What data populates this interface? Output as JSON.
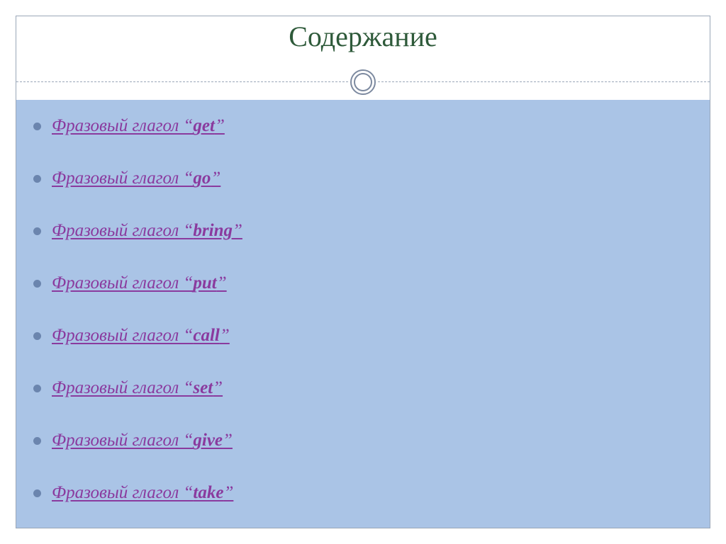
{
  "title": "Содержание",
  "item_prefix": "Фразовый глагол “",
  "item_suffix": "”",
  "items": [
    {
      "word": "get"
    },
    {
      "word": "go"
    },
    {
      "word": "bring"
    },
    {
      "word": "put"
    },
    {
      "word": "call"
    },
    {
      "word": "set"
    },
    {
      "word": "give"
    },
    {
      "word": "take"
    }
  ],
  "colors": {
    "title": "#2e5a3a",
    "link": "#8a3a9e",
    "body_bg": "#aac4e6",
    "bullet": "#6b85ae",
    "frame": "#9aa7b8"
  }
}
